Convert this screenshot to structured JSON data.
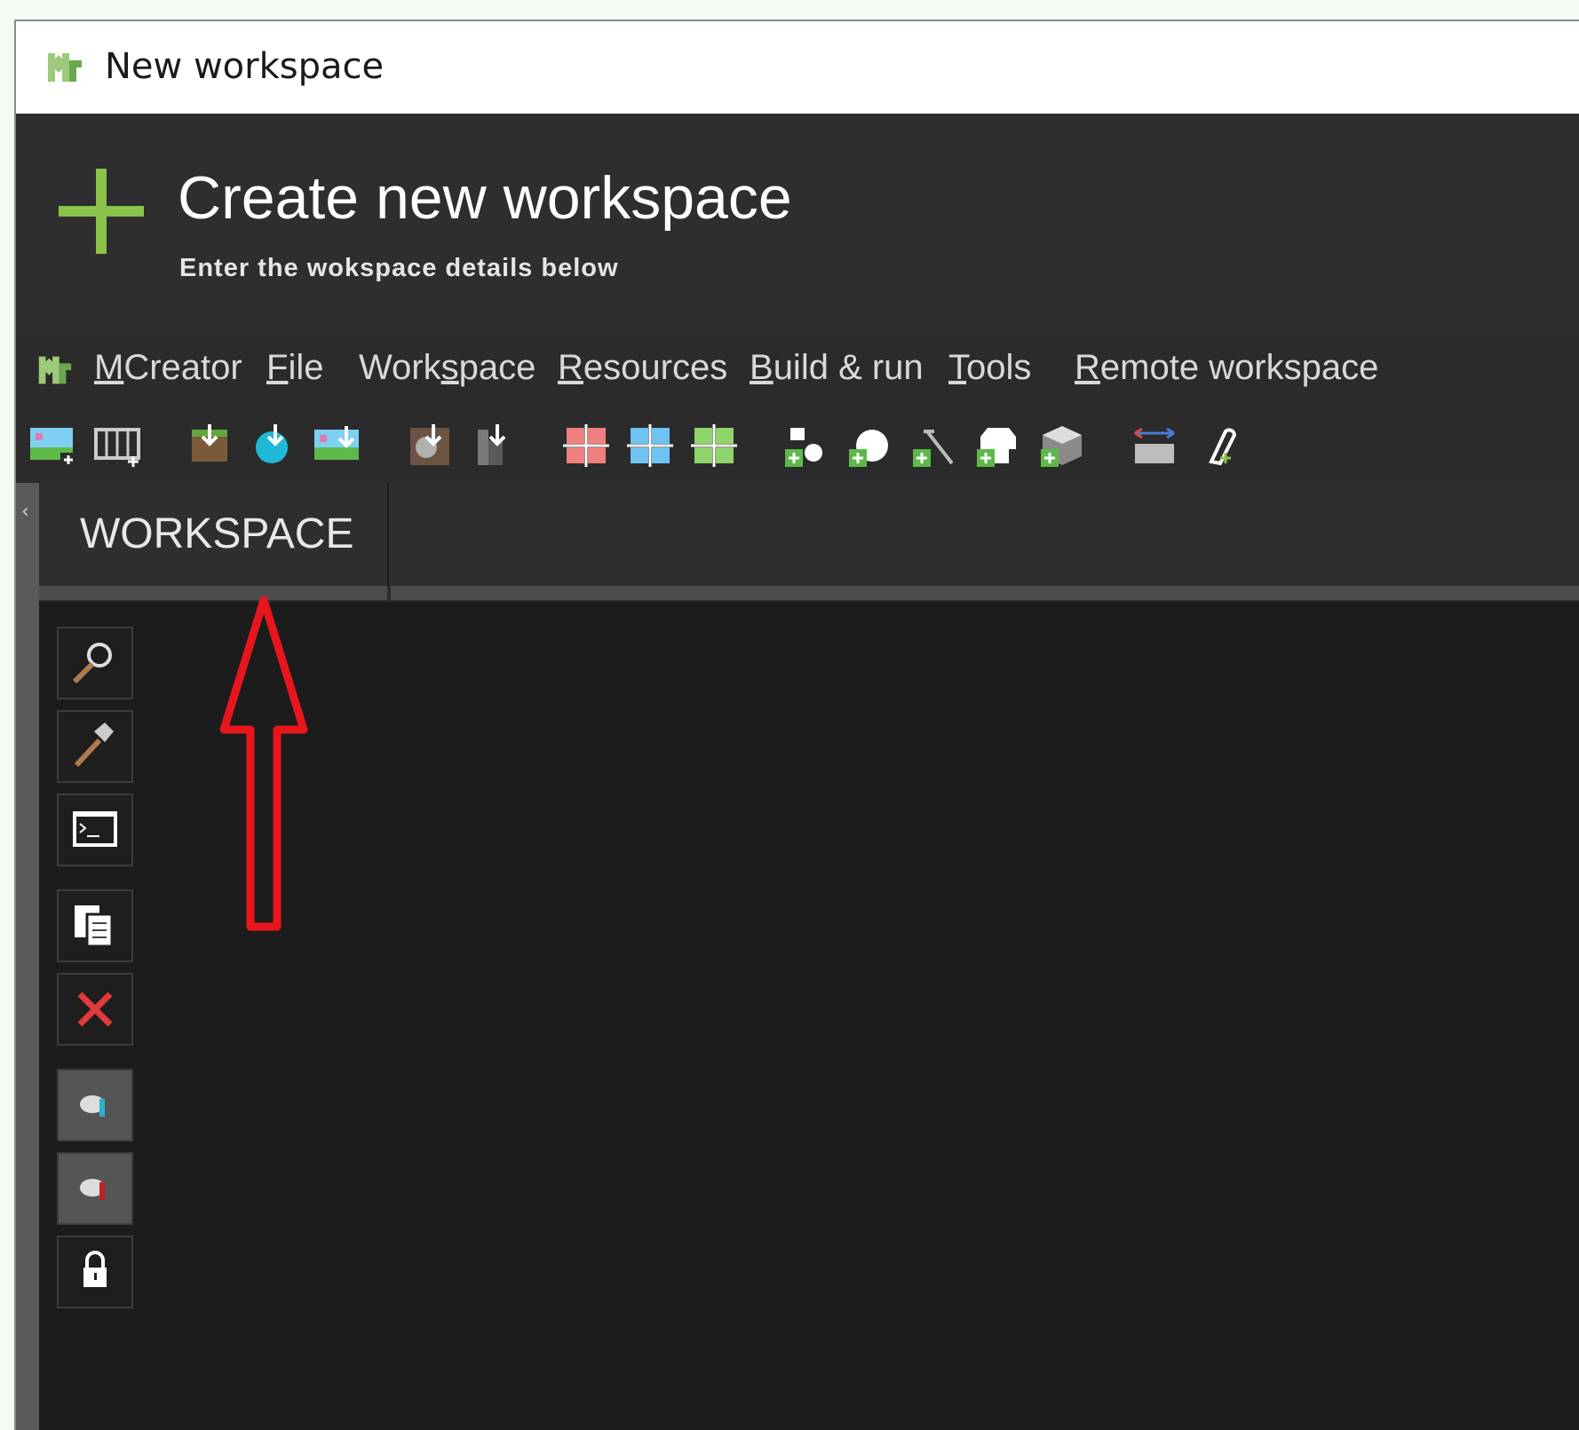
{
  "window": {
    "title": "New workspace"
  },
  "header": {
    "title": "Create new workspace",
    "subtitle": "Enter the wokspace details below"
  },
  "menubar": {
    "items": [
      {
        "pre": "",
        "ul": "M",
        "post": "Creator"
      },
      {
        "pre": "",
        "ul": "F",
        "post": "ile"
      },
      {
        "pre": "Work",
        "ul": "s",
        "post": "pace"
      },
      {
        "pre": "",
        "ul": "R",
        "post": "esources"
      },
      {
        "pre": "",
        "ul": "B",
        "post": "uild & run"
      },
      {
        "pre": "",
        "ul": "T",
        "post": "ools"
      },
      {
        "pre": "",
        "ul": "R",
        "post": "emote workspace"
      }
    ]
  },
  "toolbar": {
    "icons": [
      "image-add-icon",
      "animation-add-icon",
      "block-import-icon",
      "item-import-icon",
      "image-import-icon",
      "disc-import-icon",
      "tool-import-icon",
      "red-grid-icon",
      "blue-grid-icon",
      "green-grid-icon",
      "mob-add-icon",
      "entity-add-icon",
      "tool-add-icon",
      "armor-add-icon",
      "block-add-icon",
      "resize-icon",
      "pin-icon"
    ]
  },
  "tabs": {
    "workspace_label": "WORKSPACE"
  },
  "vertical_toolbar": {
    "buttons": [
      "search-icon",
      "build-icon",
      "console-icon",
      "duplicate-icon",
      "delete-icon",
      "lock-blue-icon",
      "lock-red-icon",
      "lock-icon"
    ]
  },
  "colors": {
    "accent_green": "#8bc34a",
    "annotation_arrow": "#e8161c",
    "background_dark": "#1c1c1c",
    "panel_dark": "#2e2e2e"
  }
}
